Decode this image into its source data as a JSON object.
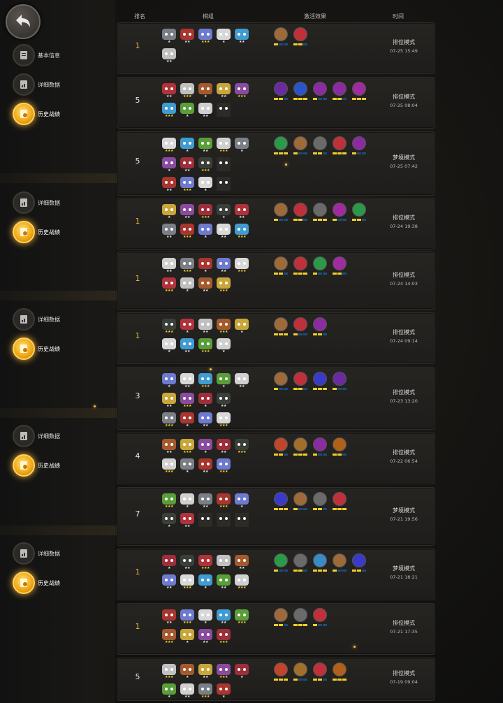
{
  "header": {
    "rank": "排名",
    "lineup": "棋组",
    "traits": "激活效果",
    "time": "时间"
  },
  "sidebar": {
    "basic": "基本信息",
    "detail": "详细数据",
    "history": "历史战绩"
  },
  "rows": [
    {
      "rank": "1",
      "mode": "排位模式",
      "time": "07-25 15:49"
    },
    {
      "rank": "5",
      "mode": "排位模式",
      "time": "07-25 08:04"
    },
    {
      "rank": "5",
      "mode": "梦境模式",
      "time": "07-25 07:42"
    },
    {
      "rank": "1",
      "mode": "排位模式",
      "time": "07-24 19:38"
    },
    {
      "rank": "1",
      "mode": "排位模式",
      "time": "07-24 14:03"
    },
    {
      "rank": "1",
      "mode": "排位模式",
      "time": "07-24 09:14"
    },
    {
      "rank": "3",
      "mode": "排位模式",
      "time": "07-23 13:20"
    },
    {
      "rank": "4",
      "mode": "排位模式",
      "time": "07-22 06:54"
    },
    {
      "rank": "7",
      "mode": "梦境模式",
      "time": "07-21 19:56"
    },
    {
      "rank": "1",
      "mode": "梦境模式",
      "time": "07-21 18:21"
    },
    {
      "rank": "1",
      "mode": "排位模式",
      "time": "07-21 17:35"
    },
    {
      "rank": "5",
      "mode": "排位模式",
      "time": "07-19 09:04"
    }
  ],
  "colors": {
    "gold": "#e6bd3a",
    "star_gold": "#ffd32a",
    "active_icon": "#f0a512"
  }
}
